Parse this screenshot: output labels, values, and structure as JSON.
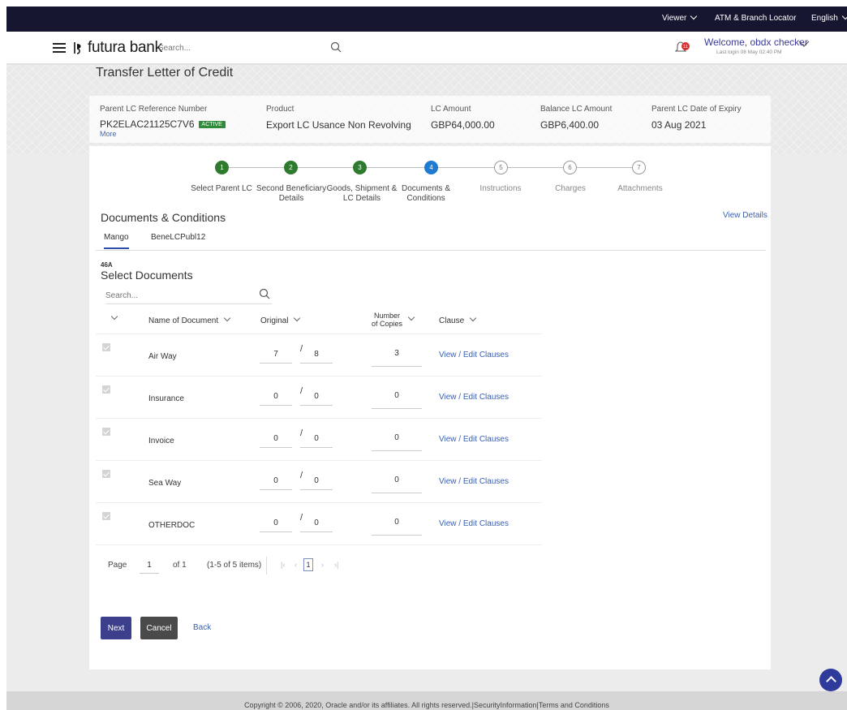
{
  "topbar": {
    "viewer": "Viewer",
    "atm_locator": "ATM & Branch Locator",
    "language": "English"
  },
  "header": {
    "logo_text": "futura bank",
    "search_placeholder": "Search...",
    "notification_count": "11",
    "welcome": "Welcome, obdx checker",
    "last_login": "Last login 08 May 02:40 PM"
  },
  "page_title": "Transfer Letter of Credit",
  "summary": {
    "ref_label": "Parent LC Reference Number",
    "ref_value": "PK2ELAC21125C7V6",
    "status_badge": "ACTIVE",
    "more": "More",
    "product_label": "Product",
    "product_value": "Export LC Usance Non Revolving",
    "amount_label": "LC Amount",
    "amount_value": "GBP64,000.00",
    "balance_label": "Balance LC Amount",
    "balance_value": "GBP6,400.00",
    "expiry_label": "Parent LC Date of Expiry",
    "expiry_value": "03 Aug 2021"
  },
  "stepper": [
    {
      "num": "1",
      "label": "Select Parent LC",
      "state": "done"
    },
    {
      "num": "2",
      "label": "Second Beneficiary Details",
      "state": "done"
    },
    {
      "num": "3",
      "label": "Goods, Shipment & LC Details",
      "state": "done"
    },
    {
      "num": "4",
      "label": "Documents & Conditions",
      "state": "active"
    },
    {
      "num": "5",
      "label": "Instructions",
      "state": "todo"
    },
    {
      "num": "6",
      "label": "Charges",
      "state": "todo"
    },
    {
      "num": "7",
      "label": "Attachments",
      "state": "todo"
    }
  ],
  "section": {
    "title": "Documents & Conditions",
    "view_details": "View Details",
    "tabs": [
      "Mango",
      "BeneLCPubl12"
    ],
    "code": "46A",
    "subtitle": "Select Documents",
    "search_placeholder": "Search..."
  },
  "table": {
    "headers": {
      "name": "Name of Document",
      "original": "Original",
      "copies_line1": "Number",
      "copies_line2": "of Copies",
      "clause": "Clause"
    },
    "rows": [
      {
        "name": "Air Way",
        "orig_a": "7",
        "orig_b": "8",
        "copies": "3",
        "clause": "View / Edit Clauses"
      },
      {
        "name": "Insurance",
        "orig_a": "0",
        "orig_b": "0",
        "copies": "0",
        "clause": "View / Edit Clauses"
      },
      {
        "name": "Invoice",
        "orig_a": "0",
        "orig_b": "0",
        "copies": "0",
        "clause": "View / Edit Clauses"
      },
      {
        "name": "Sea Way",
        "orig_a": "0",
        "orig_b": "0",
        "copies": "0",
        "clause": "View / Edit Clauses"
      },
      {
        "name": "OTHERDOC",
        "orig_a": "0",
        "orig_b": "0",
        "copies": "0",
        "clause": "View / Edit Clauses"
      }
    ]
  },
  "pager": {
    "page_label": "Page",
    "page_value": "1",
    "of_label": "of 1",
    "items": "(1-5 of 5 items)",
    "current": "1",
    "first": "|‹",
    "prev": "‹",
    "next": "›",
    "last": "›|"
  },
  "actions": {
    "next": "Next",
    "cancel": "Cancel",
    "back": "Back"
  },
  "footer": "Copyright © 2006, 2020, Oracle and/or its affiliates. All rights reserved.|SecurityInformation|Terms and Conditions",
  "colors": {
    "topbar": "#161630",
    "primary_button": "#3c3f8c",
    "step_done": "#2e7a2e",
    "step_active": "#1d7bd2",
    "link": "#3a5fb0"
  }
}
